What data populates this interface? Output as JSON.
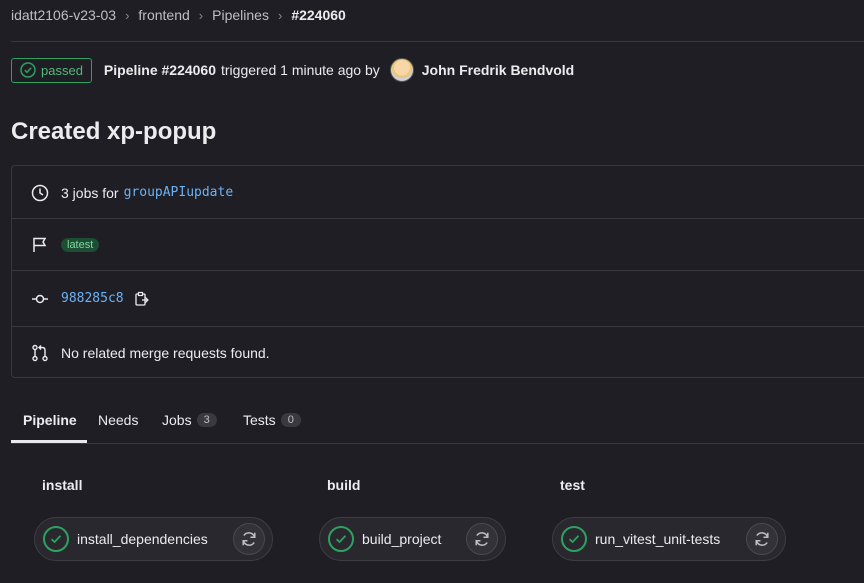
{
  "breadcrumb": {
    "items": [
      "idatt2106-v23-03",
      "frontend",
      "Pipelines"
    ],
    "current": "#224060",
    "separator": "›"
  },
  "status": {
    "label": "passed",
    "color": "#2da160",
    "icon": "check-circle-icon"
  },
  "pipeline": {
    "id_label": "Pipeline #224060",
    "triggered_text": "triggered 1 minute ago by",
    "author": "John Fredrik Bendvold"
  },
  "title": "Created xp-popup",
  "info": {
    "jobs_prefix": "3 jobs for",
    "branch": "groupAPIupdate",
    "latest_badge": "latest",
    "commit": "988285c8",
    "merge_requests": "No related merge requests found."
  },
  "tabs": {
    "pipeline": "Pipeline",
    "needs": "Needs",
    "jobs": "Jobs",
    "jobs_count": "3",
    "tests": "Tests",
    "tests_count": "0"
  },
  "stages": [
    {
      "name": "install",
      "job": "install_dependencies"
    },
    {
      "name": "build",
      "job": "build_project"
    },
    {
      "name": "test",
      "job": "run_vitest_unit-tests"
    }
  ]
}
